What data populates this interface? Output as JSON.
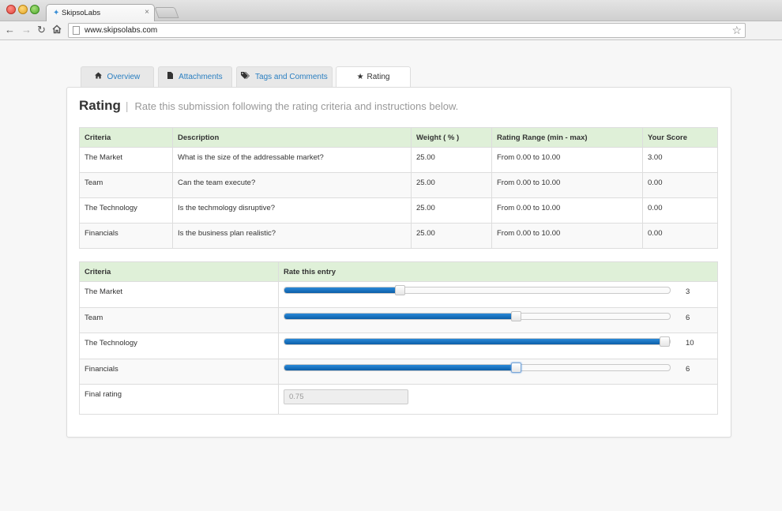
{
  "browser": {
    "tab_title": "SkipsoLabs",
    "tab_close": "×",
    "url": "www.skipsolabs.com"
  },
  "tabs": [
    {
      "label": "Overview",
      "icon": "home-icon",
      "active": false
    },
    {
      "label": "Attachments",
      "icon": "file-icon",
      "active": false
    },
    {
      "label": "Tags and Comments",
      "icon": "tags-icon",
      "active": false
    },
    {
      "label": "Rating",
      "icon": "star-icon",
      "active": true
    }
  ],
  "heading": {
    "title": "Rating",
    "separator": "|",
    "subtitle": "Rate this submission following the rating criteria and instructions below."
  },
  "criteria_table": {
    "headers": [
      "Criteria",
      "Description",
      "Weight ( % )",
      "Rating Range (min - max)",
      "Your Score"
    ],
    "rows": [
      [
        "The Market",
        "What is the size of the addressable market?",
        "25.00",
        "From 0.00 to 10.00",
        "3.00"
      ],
      [
        "Team",
        "Can the team execute?",
        "25.00",
        "From 0.00 to 10.00",
        "0.00"
      ],
      [
        "The Technology",
        "Is the techmology disruptive?",
        "25.00",
        "From 0.00 to 10.00",
        "0.00"
      ],
      [
        "Financials",
        "Is the business plan realistic?",
        "25.00",
        "From 0.00 to 10.00",
        "0.00"
      ]
    ]
  },
  "rating_table": {
    "headers": [
      "Criteria",
      "Rate this entry"
    ],
    "scale_max": 10,
    "rows": [
      {
        "label": "The Market",
        "value": 3,
        "focused": false
      },
      {
        "label": "Team",
        "value": 6,
        "focused": false
      },
      {
        "label": "The Technology",
        "value": 10,
        "focused": false
      },
      {
        "label": "Financials",
        "value": 6,
        "focused": true
      }
    ],
    "final_label": "Final rating",
    "final_value": "0.75"
  },
  "colors": {
    "accent": "#2a7fc1",
    "header_bg": "#dff0d8",
    "slider_fill": "#1a73c4"
  }
}
